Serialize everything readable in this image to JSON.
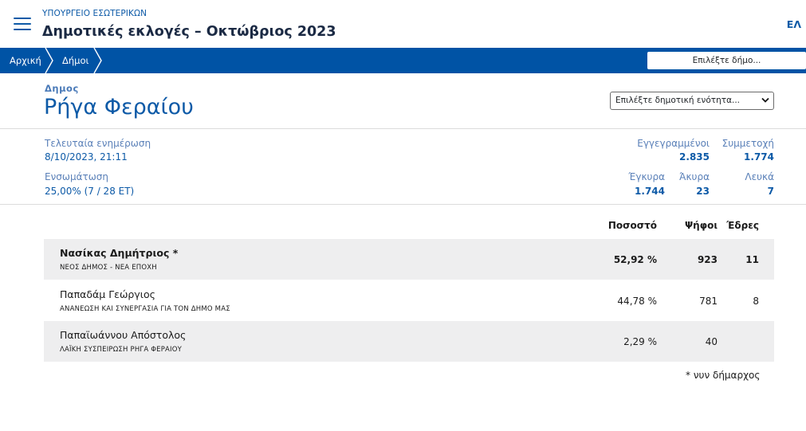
{
  "header": {
    "ministry": "ΥΠΟΥΡΓΕΙΟ ΕΣΩΤΕΡΙΚΩΝ",
    "title": "Δημοτικές εκλογές – Οκτώβριος 2023",
    "language": "ΕΛ",
    "menu_icon": "hamburger-menu-icon"
  },
  "nav": {
    "breadcrumbs": [
      "Αρχική",
      "Δήμοι"
    ],
    "municipality_select_placeholder": "Επιλέξτε δήμο..."
  },
  "municipality": {
    "label": "Δημος",
    "name": "Ρήγα Φεραίου",
    "unit_select_placeholder": "Επιλέξτε δημοτική ενότητα..."
  },
  "stats": {
    "last_update_label": "Τελευταία ενημέρωση",
    "last_update_value": "8/10/2023, 21:11",
    "integration_label": "Ενσωμάτωση",
    "integration_value": "25,00% (7 / 28 ΕΤ)",
    "registered_label": "Εγγεγραμμένοι",
    "registered_value": "2.835",
    "turnout_label": "Συμμετοχή",
    "turnout_value": "1.774",
    "valid_label": "Έγκυρα",
    "valid_value": "1.744",
    "invalid_label": "Άκυρα",
    "invalid_value": "23",
    "blank_label": "Λευκά",
    "blank_value": "7"
  },
  "results": {
    "headers": {
      "percent": "Ποσοστό",
      "votes": "Ψήφοι",
      "seats": "Έδρες"
    },
    "rows": [
      {
        "name": "Νασίκας Δημήτριος *",
        "party": "ΝΕΟΣ ΔΗΜΟΣ - ΝΕΑ ΕΠΟΧΗ",
        "percent": "52,92 %",
        "votes": "923",
        "seats": "11"
      },
      {
        "name": "Παπαδάμ Γεώργιος",
        "party": "ΑΝΑΝΕΩΣΗ ΚΑΙ ΣΥΝΕΡΓΑΣΙΑ ΓΙΑ ΤΟΝ ΔΗΜΟ ΜΑΣ",
        "percent": "44,78 %",
        "votes": "781",
        "seats": "8"
      },
      {
        "name": "Παπαϊωάννου Απόστολος",
        "party": "ΛΑΪΚΗ ΣΥΣΠΕΙΡΩΣΗ ΡΗΓΑ ΦΕΡΑΙΟΥ",
        "percent": "2,29 %",
        "votes": "40",
        "seats": ""
      }
    ],
    "footnote": "* νυν δήμαρχος"
  },
  "colors": {
    "navbar": "#0053a5",
    "accent": "#0d5aa7",
    "row_shade": "#eeeeef"
  }
}
